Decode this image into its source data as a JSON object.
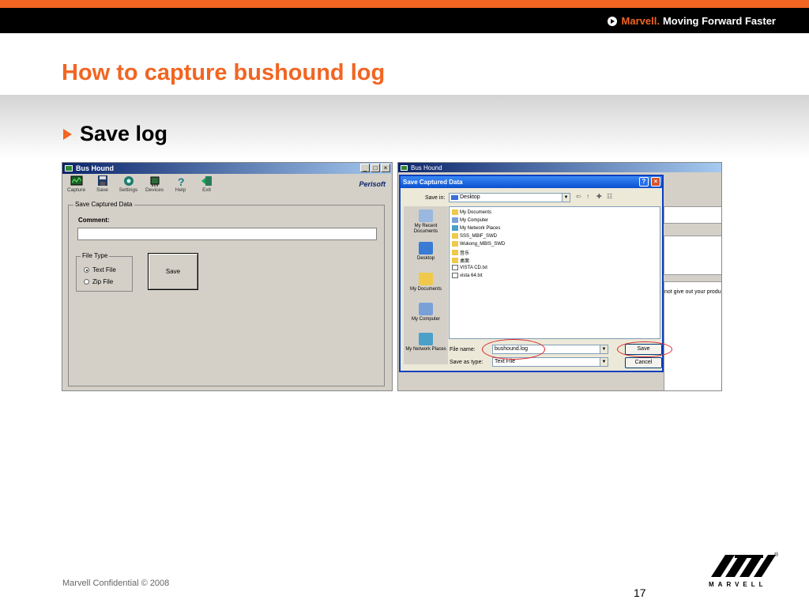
{
  "header": {
    "brand": "Marvell.",
    "tagline": "Moving Forward Faster"
  },
  "slide": {
    "title": "How to capture bushound log",
    "bullet": "Save log",
    "page_number": "17"
  },
  "footer": {
    "confidential": "Marvell Confidential © 2008",
    "logo_text": "MARVELL",
    "logo_mark": "®"
  },
  "bushound": {
    "window_title": "Bus Hound",
    "window_buttons": [
      "_",
      "□",
      "×"
    ],
    "toolbar": [
      "Capture",
      "Save",
      "Settings",
      "Devices",
      "Help",
      "Exit"
    ],
    "vendor": "Perisoft",
    "group_title": "Save Captured Data",
    "comment_label": "Comment:",
    "file_type_label": "File Type",
    "options": [
      "Text File",
      "Zip File"
    ],
    "selected_option": "Text File",
    "save_button": "Save"
  },
  "save_dialog": {
    "background_title": "Bus Hound",
    "background_text": "not give out your produ",
    "title": "Save Captured Data",
    "help_glyph": "?",
    "close_glyph": "×",
    "save_in_label": "Save in:",
    "save_in_value": "Desktop",
    "places": [
      "My Recent Documents",
      "Desktop",
      "My Documents",
      "My Computer",
      "My Network Places"
    ],
    "files": [
      "My Documents",
      "My Computer",
      "My Network Places",
      "SSS_MBIF_SWD",
      "Wukong_MBIS_SWD",
      "音乐",
      "桌面",
      "VISTA CD.txt",
      "vista 64.txt"
    ],
    "file_name_label": "File name:",
    "file_name_value": "bushound.log",
    "save_as_type_label": "Save as type:",
    "save_as_type_value": "Text File",
    "save_button": "Save",
    "cancel_button": "Cancel"
  },
  "colors": {
    "accent": "#f26522",
    "header_bg": "#000000",
    "highlight": "#d9252b"
  }
}
